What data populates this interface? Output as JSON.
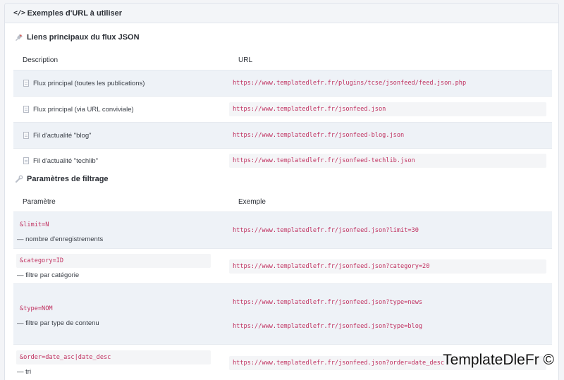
{
  "header": {
    "icon": "code-icon",
    "title": "Exemples d'URL à utiliser"
  },
  "section_feeds": {
    "icon": "pin-icon",
    "title": "Liens principaux du flux JSON",
    "columns": [
      "Description",
      "URL"
    ],
    "rows": [
      {
        "label": "Flux principal (toutes les publications)",
        "url": "https://www.templatedlefr.fr/plugins/tcse/jsonfeed/feed.json.php"
      },
      {
        "label": "Flux principal (via URL conviviale)",
        "url": "https://www.templatedlefr.fr/jsonfeed.json"
      },
      {
        "label": "Fil d'actualité \"blog\"",
        "url": "https://www.templatedlefr.fr/jsonfeed-blog.json"
      },
      {
        "label": "Fil d'actualité \"techlib\"",
        "url": "https://www.templatedlefr.fr/jsonfeed-techlib.json"
      }
    ]
  },
  "section_filters": {
    "icon": "wrench-icon",
    "title": "Paramètres de filtrage",
    "columns": [
      "Paramètre",
      "Exemple"
    ],
    "rows": [
      {
        "param": "&limit=N",
        "desc": "— nombre d'enregistrements",
        "examples": [
          "https://www.templatedlefr.fr/jsonfeed.json?limit=30"
        ]
      },
      {
        "param": "&category=ID",
        "desc": "— filtre par catégorie",
        "examples": [
          "https://www.templatedlefr.fr/jsonfeed.json?category=20"
        ]
      },
      {
        "param": "&type=NOM",
        "desc": "— filtre par type de contenu",
        "examples": [
          "https://www.templatedlefr.fr/jsonfeed.json?type=news",
          "https://www.templatedlefr.fr/jsonfeed.json?type=blog"
        ]
      },
      {
        "param": "&order=date_asc|date_desc",
        "desc": "— tri",
        "examples": [
          "https://www.templatedlefr.fr/jsonfeed.json?order=date_desc"
        ]
      }
    ]
  },
  "watermark": "TemplateDleFr ©"
}
